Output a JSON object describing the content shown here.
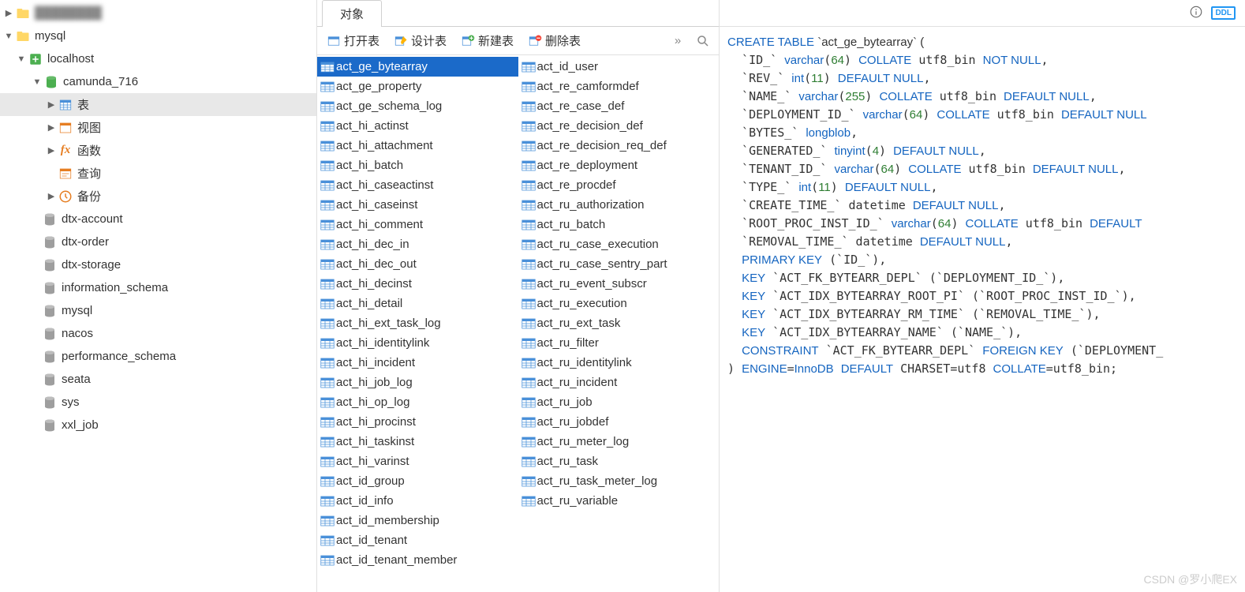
{
  "sidebar": {
    "root": "mysql",
    "connection": "localhost",
    "active_db": "camunda_716",
    "nodes": {
      "tables": "表",
      "views": "视图",
      "functions": "函数",
      "queries": "查询",
      "backup": "备份"
    },
    "other_dbs": [
      "dtx-account",
      "dtx-order",
      "dtx-storage",
      "information_schema",
      "mysql",
      "nacos",
      "performance_schema",
      "seata",
      "sys",
      "xxl_job"
    ]
  },
  "middle": {
    "tab_label": "对象",
    "toolbar": {
      "open": "打开表",
      "design": "设计表",
      "new": "新建表",
      "delete": "删除表"
    },
    "selected_table": "act_ge_bytearray",
    "tables_col1": [
      "act_ge_bytearray",
      "act_ge_property",
      "act_ge_schema_log",
      "act_hi_actinst",
      "act_hi_attachment",
      "act_hi_batch",
      "act_hi_caseactinst",
      "act_hi_caseinst",
      "act_hi_comment",
      "act_hi_dec_in",
      "act_hi_dec_out",
      "act_hi_decinst",
      "act_hi_detail",
      "act_hi_ext_task_log",
      "act_hi_identitylink",
      "act_hi_incident",
      "act_hi_job_log",
      "act_hi_op_log",
      "act_hi_procinst",
      "act_hi_taskinst",
      "act_hi_varinst",
      "act_id_group",
      "act_id_info",
      "act_id_membership",
      "act_id_tenant",
      "act_id_tenant_member"
    ],
    "tables_col2": [
      "act_id_user",
      "act_re_camformdef",
      "act_re_case_def",
      "act_re_decision_def",
      "act_re_decision_req_def",
      "act_re_deployment",
      "act_re_procdef",
      "act_ru_authorization",
      "act_ru_batch",
      "act_ru_case_execution",
      "act_ru_case_sentry_part",
      "act_ru_event_subscr",
      "act_ru_execution",
      "act_ru_ext_task",
      "act_ru_filter",
      "act_ru_identitylink",
      "act_ru_incident",
      "act_ru_job",
      "act_ru_jobdef",
      "act_ru_meter_log",
      "act_ru_task",
      "act_ru_task_meter_log",
      "act_ru_variable"
    ]
  },
  "ddl": {
    "lines": [
      [
        [
          "kw",
          "CREATE TABLE"
        ],
        [
          "",
          ""
        ],
        [
          "str",
          " `act_ge_bytearray` ("
        ]
      ],
      [
        [
          "",
          "  `ID_` "
        ],
        [
          "ty",
          "varchar"
        ],
        [
          "",
          "("
        ],
        [
          "num",
          "64"
        ],
        [
          "",
          ") "
        ],
        [
          "kw",
          "COLLATE"
        ],
        [
          "",
          " utf8_bin "
        ],
        [
          "kw",
          "NOT NULL"
        ],
        [
          "",
          ","
        ]
      ],
      [
        [
          "",
          "  `REV_` "
        ],
        [
          "ty",
          "int"
        ],
        [
          "",
          "("
        ],
        [
          "num",
          "11"
        ],
        [
          "",
          ") "
        ],
        [
          "kw",
          "DEFAULT NULL"
        ],
        [
          "",
          ","
        ]
      ],
      [
        [
          "",
          "  `NAME_` "
        ],
        [
          "ty",
          "varchar"
        ],
        [
          "",
          "("
        ],
        [
          "num",
          "255"
        ],
        [
          "",
          ") "
        ],
        [
          "kw",
          "COLLATE"
        ],
        [
          "",
          " utf8_bin "
        ],
        [
          "kw",
          "DEFAULT NULL"
        ],
        [
          "",
          ","
        ]
      ],
      [
        [
          "",
          "  `DEPLOYMENT_ID_` "
        ],
        [
          "ty",
          "varchar"
        ],
        [
          "",
          "("
        ],
        [
          "num",
          "64"
        ],
        [
          "",
          ") "
        ],
        [
          "kw",
          "COLLATE"
        ],
        [
          "",
          " utf8_bin "
        ],
        [
          "kw",
          "DEFAULT NULL"
        ]
      ],
      [
        [
          "",
          "  `BYTES_` "
        ],
        [
          "ty",
          "longblob"
        ],
        [
          "",
          ","
        ]
      ],
      [
        [
          "",
          "  `GENERATED_` "
        ],
        [
          "ty",
          "tinyint"
        ],
        [
          "",
          "("
        ],
        [
          "num",
          "4"
        ],
        [
          "",
          ") "
        ],
        [
          "kw",
          "DEFAULT NULL"
        ],
        [
          "",
          ","
        ]
      ],
      [
        [
          "",
          "  `TENANT_ID_` "
        ],
        [
          "ty",
          "varchar"
        ],
        [
          "",
          "("
        ],
        [
          "num",
          "64"
        ],
        [
          "",
          ") "
        ],
        [
          "kw",
          "COLLATE"
        ],
        [
          "",
          " utf8_bin "
        ],
        [
          "kw",
          "DEFAULT NULL"
        ],
        [
          "",
          ","
        ]
      ],
      [
        [
          "",
          "  `TYPE_` "
        ],
        [
          "ty",
          "int"
        ],
        [
          "",
          "("
        ],
        [
          "num",
          "11"
        ],
        [
          "",
          ") "
        ],
        [
          "kw",
          "DEFAULT NULL"
        ],
        [
          "",
          ","
        ]
      ],
      [
        [
          "",
          "  `CREATE_TIME_` datetime "
        ],
        [
          "kw",
          "DEFAULT NULL"
        ],
        [
          "",
          ","
        ]
      ],
      [
        [
          "",
          "  `ROOT_PROC_INST_ID_` "
        ],
        [
          "ty",
          "varchar"
        ],
        [
          "",
          "("
        ],
        [
          "num",
          "64"
        ],
        [
          "",
          ") "
        ],
        [
          "kw",
          "COLLATE"
        ],
        [
          "",
          " utf8_bin "
        ],
        [
          "kw",
          "DEFAULT"
        ]
      ],
      [
        [
          "",
          "  `REMOVAL_TIME_` datetime "
        ],
        [
          "kw",
          "DEFAULT NULL"
        ],
        [
          "",
          ","
        ]
      ],
      [
        [
          "",
          "  "
        ],
        [
          "kw",
          "PRIMARY KEY"
        ],
        [
          "",
          " (`ID_`),"
        ]
      ],
      [
        [
          "",
          "  "
        ],
        [
          "kw",
          "KEY"
        ],
        [
          "",
          " `ACT_FK_BYTEARR_DEPL` (`DEPLOYMENT_ID_`),"
        ]
      ],
      [
        [
          "",
          "  "
        ],
        [
          "kw",
          "KEY"
        ],
        [
          "",
          " `ACT_IDX_BYTEARRAY_ROOT_PI` (`ROOT_PROC_INST_ID_`),"
        ]
      ],
      [
        [
          "",
          "  "
        ],
        [
          "kw",
          "KEY"
        ],
        [
          "",
          " `ACT_IDX_BYTEARRAY_RM_TIME` (`REMOVAL_TIME_`),"
        ]
      ],
      [
        [
          "",
          "  "
        ],
        [
          "kw",
          "KEY"
        ],
        [
          "",
          " `ACT_IDX_BYTEARRAY_NAME` (`NAME_`),"
        ]
      ],
      [
        [
          "",
          "  "
        ],
        [
          "kw",
          "CONSTRAINT"
        ],
        [
          "",
          " `ACT_FK_BYTEARR_DEPL` "
        ],
        [
          "kw",
          "FOREIGN KEY"
        ],
        [
          "",
          " (`DEPLOYMENT_"
        ]
      ],
      [
        [
          "",
          ") "
        ],
        [
          "kw",
          "ENGINE"
        ],
        [
          "",
          "="
        ],
        [
          "ty",
          "InnoDB"
        ],
        [
          "",
          " "
        ],
        [
          "kw",
          "DEFAULT"
        ],
        [
          "",
          " CHARSET=utf8 "
        ],
        [
          "kw",
          "COLLATE"
        ],
        [
          "",
          "=utf8_bin;"
        ]
      ]
    ]
  },
  "watermark": "CSDN @罗小爬EX"
}
